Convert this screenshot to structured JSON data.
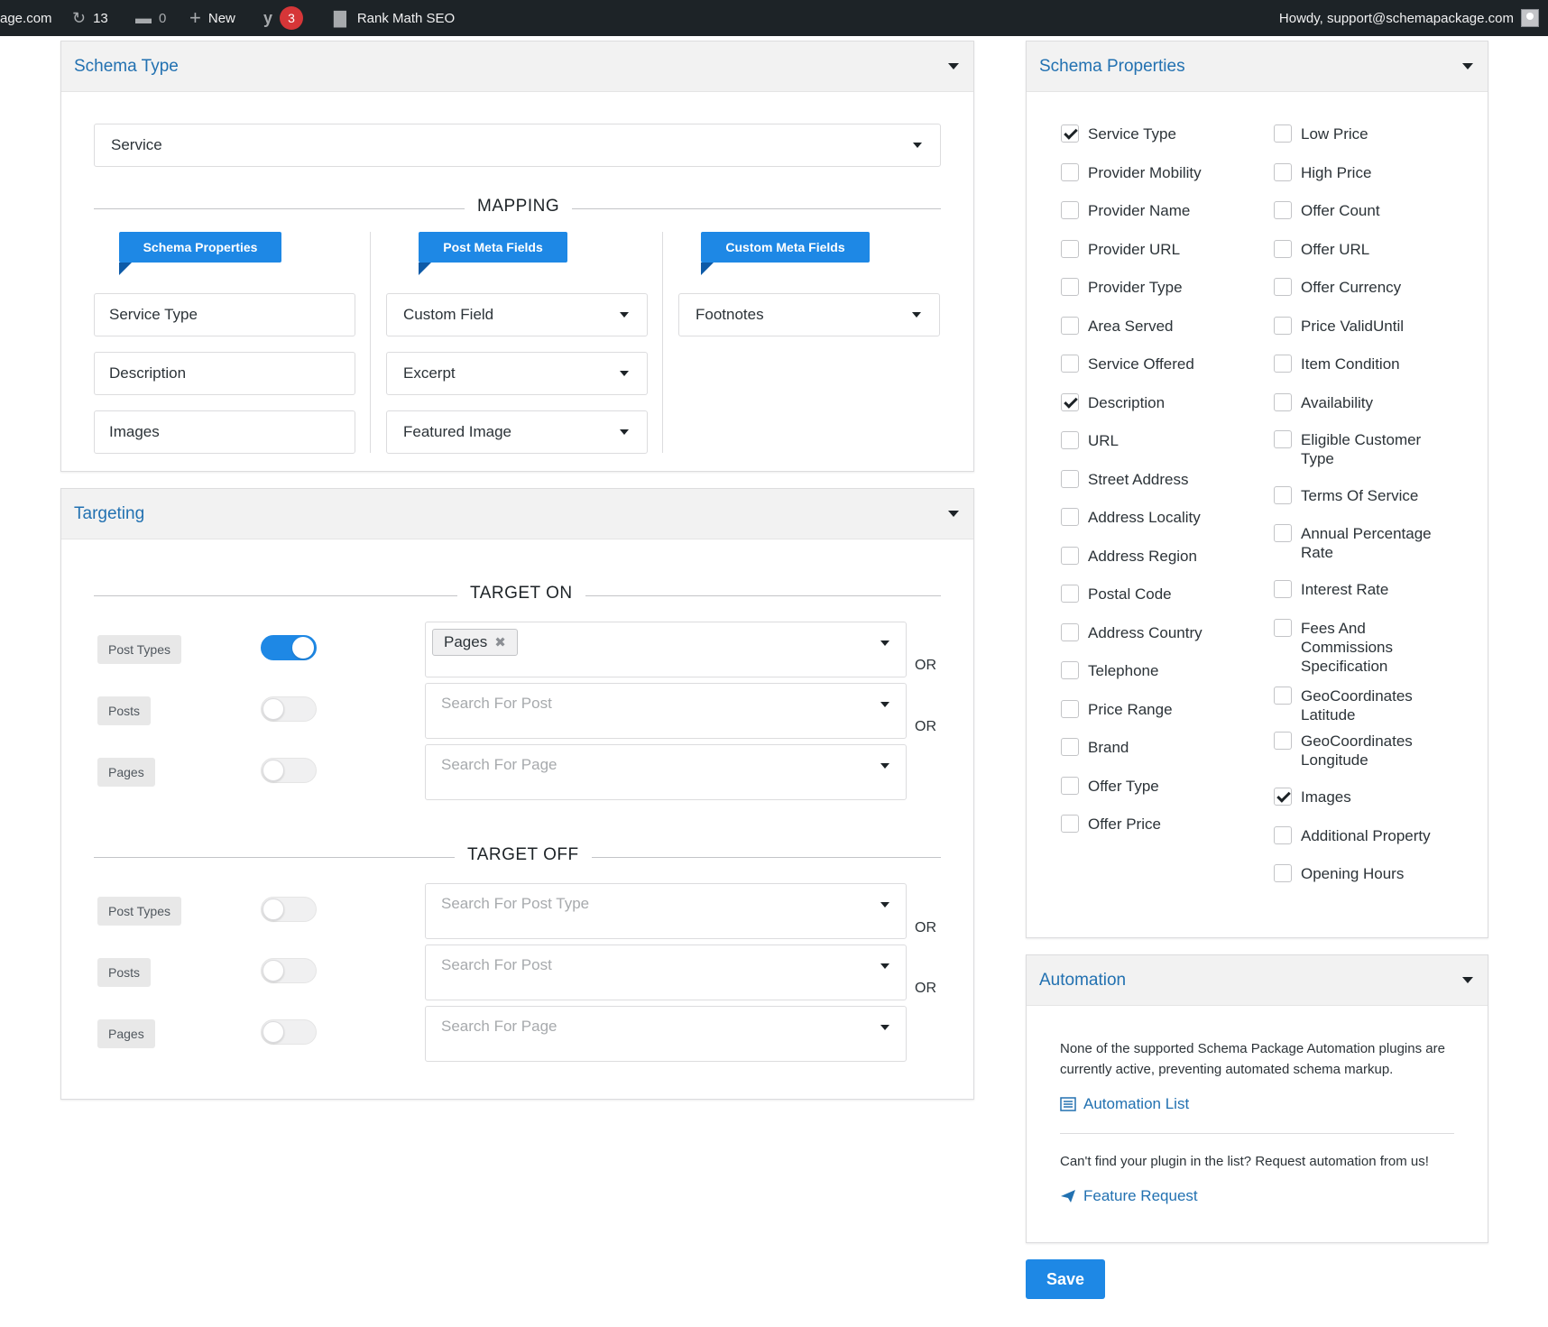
{
  "adminbar": {
    "site": "age.com",
    "updates_count": "13",
    "comments_count": "0",
    "new_label": "New",
    "notifications_count": "3",
    "rankmath_label": "Rank Math SEO",
    "howdy": "Howdy, support@schemapackage.com"
  },
  "schema_type_panel": {
    "title": "Schema Type",
    "selected_type": "Service",
    "mapping_label": "MAPPING",
    "columns": [
      "Schema Properties",
      "Post Meta Fields",
      "Custom Meta Fields"
    ],
    "rows": [
      {
        "property": "Service Type",
        "post_meta": "Custom Field",
        "custom_meta": "Footnotes"
      },
      {
        "property": "Description",
        "post_meta": "Excerpt"
      },
      {
        "property": "Images",
        "post_meta": "Featured Image"
      }
    ]
  },
  "targeting_panel": {
    "title": "Targeting",
    "target_on_label": "TARGET ON",
    "target_off_label": "TARGET OFF",
    "target_on": [
      {
        "label": "Post Types",
        "enabled": true,
        "tag": "Pages",
        "placeholder": ""
      },
      {
        "label": "Posts",
        "enabled": false,
        "placeholder": "Search For Post"
      },
      {
        "label": "Pages",
        "enabled": false,
        "placeholder": "Search For Page"
      }
    ],
    "target_off": [
      {
        "label": "Post Types",
        "enabled": false,
        "placeholder": "Search For Post Type"
      },
      {
        "label": "Posts",
        "enabled": false,
        "placeholder": "Search For Post"
      },
      {
        "label": "Pages",
        "enabled": false,
        "placeholder": "Search For Page"
      }
    ],
    "or_label": "OR"
  },
  "schema_properties_panel": {
    "title": "Schema Properties",
    "left": [
      {
        "label": "Service Type",
        "checked": true
      },
      {
        "label": "Provider Mobility",
        "checked": false
      },
      {
        "label": "Provider Name",
        "checked": false
      },
      {
        "label": "Provider URL",
        "checked": false
      },
      {
        "label": "Provider Type",
        "checked": false
      },
      {
        "label": "Area Served",
        "checked": false
      },
      {
        "label": "Service Offered",
        "checked": false
      },
      {
        "label": "Description",
        "checked": true
      },
      {
        "label": "URL",
        "checked": false
      },
      {
        "label": "Street Address",
        "checked": false
      },
      {
        "label": "Address Locality",
        "checked": false
      },
      {
        "label": "Address Region",
        "checked": false
      },
      {
        "label": "Postal Code",
        "checked": false
      },
      {
        "label": "Address Country",
        "checked": false
      },
      {
        "label": "Telephone",
        "checked": false
      },
      {
        "label": "Price Range",
        "checked": false
      },
      {
        "label": "Brand",
        "checked": false
      },
      {
        "label": "Offer Type",
        "checked": false
      },
      {
        "label": "Offer Price",
        "checked": false
      }
    ],
    "right": [
      {
        "label": "Low Price",
        "checked": false
      },
      {
        "label": "High Price",
        "checked": false
      },
      {
        "label": "Offer Count",
        "checked": false
      },
      {
        "label": "Offer URL",
        "checked": false
      },
      {
        "label": "Offer Currency",
        "checked": false
      },
      {
        "label": "Price ValidUntil",
        "checked": false
      },
      {
        "label": "Item Condition",
        "checked": false
      },
      {
        "label": "Availability",
        "checked": false
      },
      {
        "label": "Eligible Customer Type",
        "checked": false
      },
      {
        "label": "Terms Of Service",
        "checked": false
      },
      {
        "label": "Annual Percentage Rate",
        "checked": false
      },
      {
        "label": "Interest Rate",
        "checked": false
      },
      {
        "label": "Fees And Commissions Specification",
        "checked": false
      },
      {
        "label": "GeoCoordinates Latitude",
        "checked": false
      },
      {
        "label": "GeoCoordinates Longitude",
        "checked": false
      },
      {
        "label": "Images",
        "checked": true
      },
      {
        "label": "Additional Property",
        "checked": false
      },
      {
        "label": "Opening Hours",
        "checked": false
      }
    ]
  },
  "automation_panel": {
    "title": "Automation",
    "notice": "None of the supported Schema Package Automation plugins are currently active, preventing automated schema markup.",
    "list_link": "Automation List",
    "request_text": "Can't find your plugin in the list? Request automation from us!",
    "request_link": "Feature Request"
  },
  "save_label": "Save"
}
